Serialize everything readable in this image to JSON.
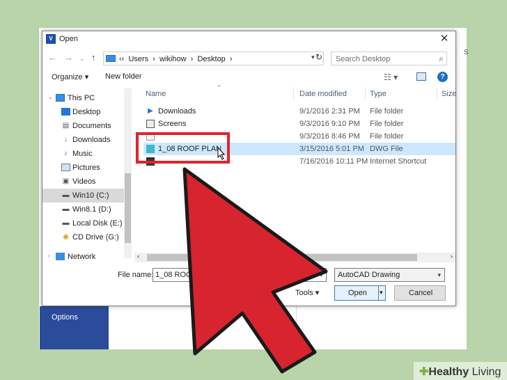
{
  "background": {
    "options_label": "Options",
    "right_edge_letter": "S"
  },
  "dialog": {
    "title": "Open",
    "app_icon_text": "V",
    "close_glyph": "✕"
  },
  "nav": {
    "back_glyph": "←",
    "forward_glyph": "→",
    "up_glyph": "↑",
    "address": "‹‹  Users  ›  wikihow  ›  Desktop  ›",
    "refresh_glyph": "↻",
    "search_placeholder": "Search Desktop",
    "search_glyph": "⌕"
  },
  "toolbar": {
    "organize": "Organize ▾",
    "new_folder": "New folder",
    "help": "?"
  },
  "sidebar": {
    "items": [
      {
        "label": "This PC",
        "icon": "pc-icon"
      },
      {
        "label": "Desktop",
        "icon": "desktop-icon"
      },
      {
        "label": "Documents",
        "icon": "documents-icon"
      },
      {
        "label": "Downloads",
        "icon": "downloads-icon"
      },
      {
        "label": "Music",
        "icon": "music-icon"
      },
      {
        "label": "Pictures",
        "icon": "pictures-icon"
      },
      {
        "label": "Videos",
        "icon": "videos-icon"
      },
      {
        "label": "Win10 (C:)",
        "icon": "drive-icon"
      },
      {
        "label": "Win8.1 (D:)",
        "icon": "drive-icon"
      },
      {
        "label": "Local Disk (E:)",
        "icon": "drive-icon"
      },
      {
        "label": "CD Drive (G:)",
        "icon": "cd-icon"
      },
      {
        "label": "Network",
        "icon": "network-icon"
      }
    ]
  },
  "columns": {
    "name": "Name",
    "date": "Date modified",
    "type": "Type",
    "size": "Size"
  },
  "files": [
    {
      "name": "Downloads",
      "date": "9/1/2016 2:31 PM",
      "type": "File folder"
    },
    {
      "name": "Screens",
      "date": "9/3/2016 9:10 PM",
      "type": "File folder"
    },
    {
      "name": "",
      "date": "9/3/2016 8:46 PM",
      "type": "File folder"
    },
    {
      "name": "1_08 ROOF PLAN",
      "date": "3/15/2016 5:01 PM",
      "type": "DWG File"
    },
    {
      "name": "",
      "date": "7/16/2016 10:11 PM",
      "type": "Internet Shortcut"
    }
  ],
  "footer": {
    "file_name_label": "File name:",
    "file_name_value": "1_08 ROC",
    "filter": "AutoCAD Drawing",
    "tools": "Tools ▾",
    "open": "Open",
    "cancel": "Cancel"
  },
  "watermark": {
    "brand_bold": "Healthy",
    "brand_rest": " Living"
  },
  "colors": {
    "highlight_red": "#e2222e",
    "selection_blue": "#cce8ff",
    "background_green": "#b8d4a8"
  }
}
